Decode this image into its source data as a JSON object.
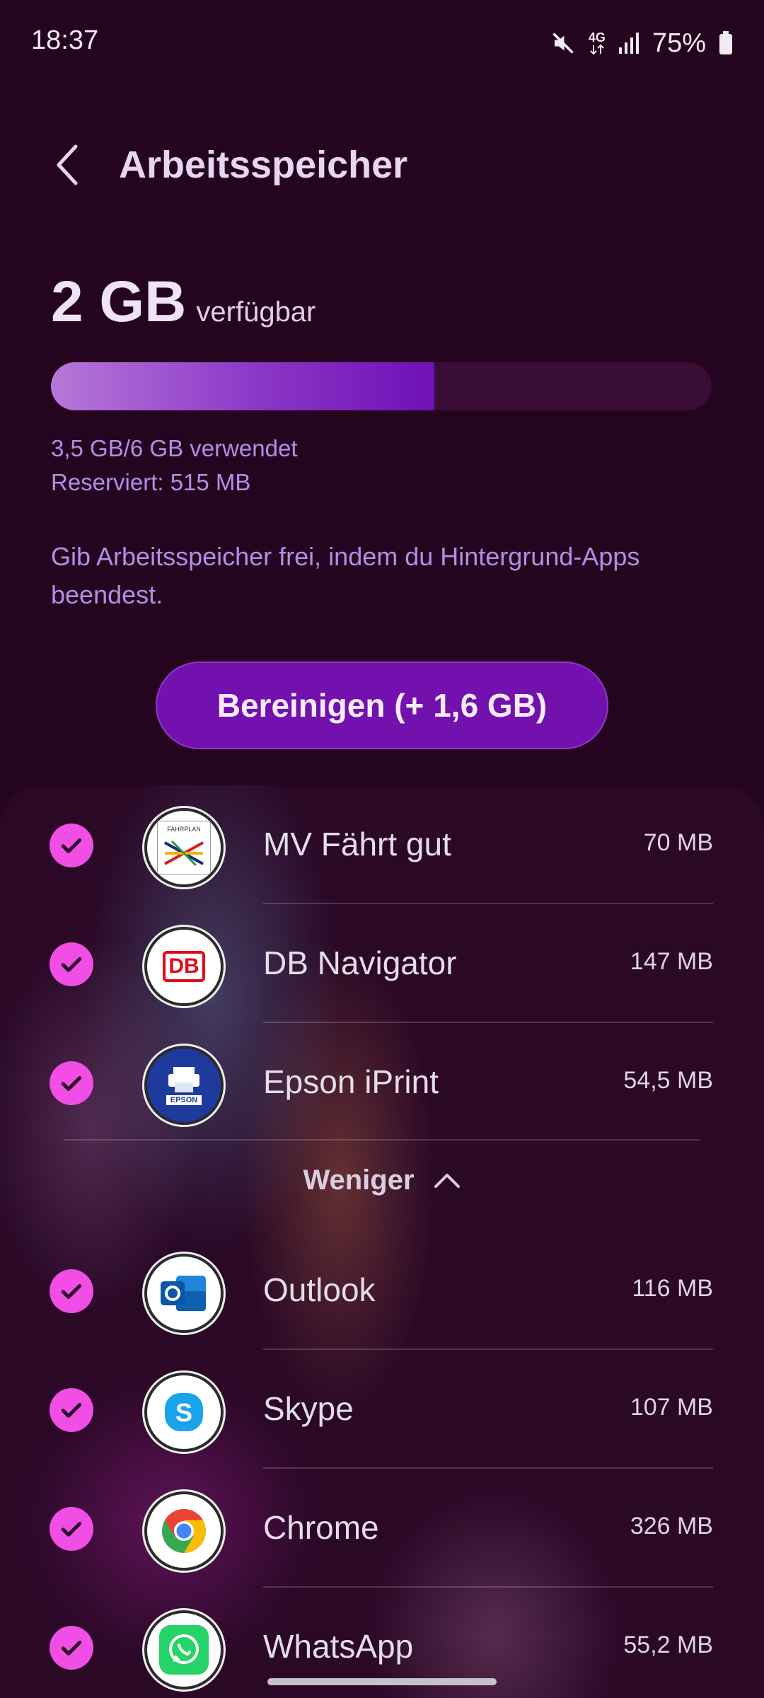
{
  "status_bar": {
    "time": "18:37",
    "network": "4G",
    "battery": "75%"
  },
  "header": {
    "title": "Arbeitsspeicher"
  },
  "summary": {
    "available_value": "2 GB",
    "available_label": "verfügbar",
    "used_text": "3,5 GB/6 GB verwendet",
    "reserved_text": "Reserviert: 515 MB",
    "used_fraction": 0.58
  },
  "hint": "Gib Arbeitsspeicher frei, indem du Hintergrund-Apps beendest.",
  "clean_button": {
    "label": "Bereinigen (+ 1,6 GB)"
  },
  "apps_top": [
    {
      "name": "MV Fährt gut",
      "size": "70 MB",
      "icon": "fahrplan-icon",
      "icon_text": "FAHRPLAN"
    },
    {
      "name": "DB Navigator",
      "size": "147 MB",
      "icon": "db-icon",
      "icon_text": "DB"
    },
    {
      "name": "Epson iPrint",
      "size": "54,5 MB",
      "icon": "epson-icon",
      "icon_text": "EPSON"
    }
  ],
  "less_toggle": {
    "label": "Weniger"
  },
  "apps_bottom": [
    {
      "name": "Outlook",
      "size": "116 MB",
      "icon": "outlook-icon"
    },
    {
      "name": "Skype",
      "size": "107 MB",
      "icon": "skype-icon"
    },
    {
      "name": "Chrome",
      "size": "326 MB",
      "icon": "chrome-icon"
    },
    {
      "name": "WhatsApp",
      "size": "55,2 MB",
      "icon": "whatsapp-icon"
    }
  ],
  "colors": {
    "background": "#25041f",
    "accent": "#7211ad",
    "check": "#f14ee6",
    "secondary_text": "#b88be6"
  }
}
